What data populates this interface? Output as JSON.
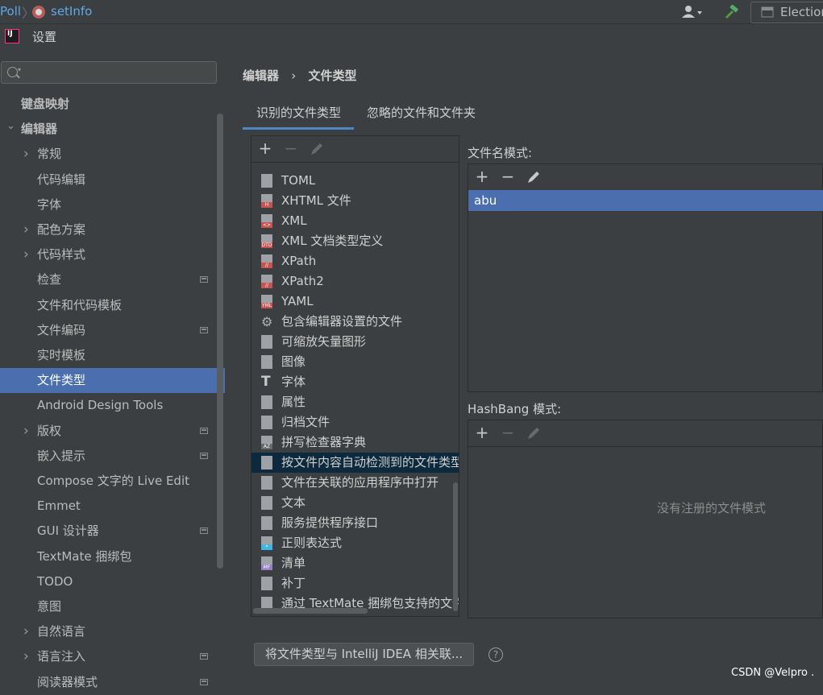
{
  "topbar": {
    "crumb_project": "Poll",
    "crumb_method": "setInfo",
    "run_config": "Election"
  },
  "window": {
    "title": "设置"
  },
  "sidebar": {
    "items": [
      {
        "label": "键盘映射",
        "bold": true
      },
      {
        "label": "编辑器",
        "bold": true,
        "expanded": true
      },
      {
        "label": "常规",
        "collapsed": true
      },
      {
        "label": "代码编辑"
      },
      {
        "label": "字体"
      },
      {
        "label": "配色方案",
        "collapsed": true
      },
      {
        "label": "代码样式",
        "collapsed": true
      },
      {
        "label": "检查",
        "project": true
      },
      {
        "label": "文件和代码模板"
      },
      {
        "label": "文件编码",
        "project": true
      },
      {
        "label": "实时模板"
      },
      {
        "label": "文件类型",
        "selected": true
      },
      {
        "label": "Android Design Tools"
      },
      {
        "label": "版权",
        "collapsed": true,
        "project": true
      },
      {
        "label": "嵌入提示",
        "collapsed": false,
        "project": true
      },
      {
        "label": "Compose 文字的 Live Edit"
      },
      {
        "label": "Emmet"
      },
      {
        "label": "GUI 设计器",
        "project": true
      },
      {
        "label": "TextMate 捆绑包"
      },
      {
        "label": "TODO"
      },
      {
        "label": "意图"
      },
      {
        "label": "自然语言",
        "collapsed": true
      },
      {
        "label": "语言注入",
        "collapsed": true,
        "project": true
      },
      {
        "label": "阅读器模式",
        "project": true
      }
    ]
  },
  "content": {
    "breadcrumb_parent": "编辑器",
    "breadcrumb_sep": "›",
    "breadcrumb_current": "文件类型",
    "tabs": [
      {
        "label": "识别的文件类型",
        "active": true
      },
      {
        "label": "忽略的文件和文件夹",
        "active": false
      }
    ],
    "file_types": [
      {
        "label": "TOML",
        "tag": ""
      },
      {
        "label": "XHTML 文件",
        "tag": "H"
      },
      {
        "label": "XML",
        "tag": "<>"
      },
      {
        "label": "XML 文档类型定义",
        "tag": "DTD"
      },
      {
        "label": "XPath",
        "tag": "//"
      },
      {
        "label": "XPath2",
        "tag": "//"
      },
      {
        "label": "YAML",
        "tag": "YML"
      },
      {
        "label": "包含编辑器设置的文件",
        "tag": "gear"
      },
      {
        "label": "可缩放矢量图形",
        "tag": ""
      },
      {
        "label": "图像",
        "tag": ""
      },
      {
        "label": "字体",
        "tag": "T"
      },
      {
        "label": "属性",
        "tag": ""
      },
      {
        "label": "归档文件",
        "tag": ""
      },
      {
        "label": "拼写检查器字典",
        "tag": "AZ"
      },
      {
        "label": "按文件内容自动检测到的文件类型",
        "tag": "",
        "selected": true
      },
      {
        "label": "文件在关联的应用程序中打开",
        "tag": ""
      },
      {
        "label": "文本",
        "tag": ""
      },
      {
        "label": "服务提供程序接口",
        "tag": ""
      },
      {
        "label": "正则表达式",
        "tag": "*"
      },
      {
        "label": "清单",
        "tag": "MF"
      },
      {
        "label": "补丁",
        "tag": ""
      },
      {
        "label": "通过 TextMate 捆绑包支持的文件",
        "tag": ""
      }
    ],
    "filename_patterns_label": "文件名模式:",
    "filename_patterns": [
      "abu"
    ],
    "hashbang_label": "HashBang 模式:",
    "hashbang_empty": "没有注册的文件模式",
    "associate_button": "将文件类型与 IntelliJ IDEA 相关联...",
    "help": "?"
  },
  "watermark": "CSDN @Velpro .",
  "colors": {
    "background": "#3c3f41",
    "selection": "#4b6eaf",
    "list_selection_inactive": "#0d293e",
    "link": "#5fa8e8"
  }
}
